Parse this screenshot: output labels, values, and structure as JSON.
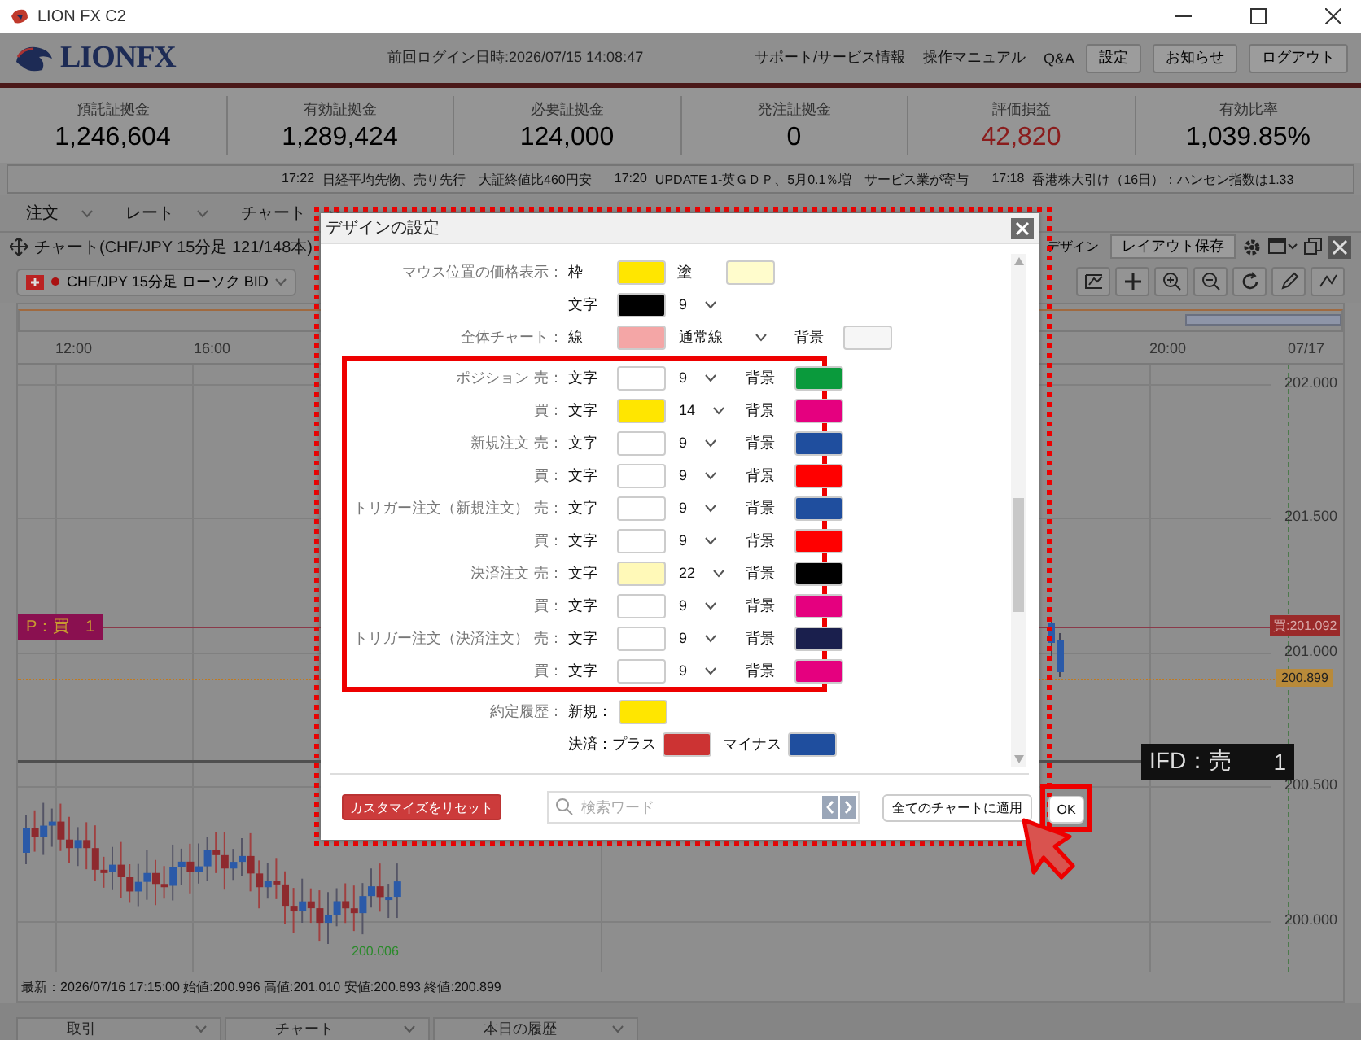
{
  "window": {
    "title": "LION FX C2"
  },
  "header": {
    "logo": "LIONFX",
    "last_login": "前回ログイン日時:2026/07/15 14:08:47",
    "links": [
      "サポート/サービス情報",
      "操作マニュアル",
      "Q&A"
    ],
    "buttons": [
      "設定",
      "お知らせ",
      "ログアウト"
    ]
  },
  "summary": [
    {
      "label": "預託証拠金",
      "value": "1,246,604",
      "kind": "plain"
    },
    {
      "label": "有効証拠金",
      "value": "1,289,424",
      "kind": "plain"
    },
    {
      "label": "必要証拠金",
      "value": "124,000",
      "kind": "plain"
    },
    {
      "label": "発注証拠金",
      "value": "0",
      "kind": "plain"
    },
    {
      "label": "評価損益",
      "value": "42,820",
      "kind": "profit"
    },
    {
      "label": "有効比率",
      "value": "1,039.85%",
      "kind": "plain"
    }
  ],
  "news": [
    {
      "time": "17:22",
      "text": "日経平均先物、売り先行　大証終値比460円安"
    },
    {
      "time": "17:20",
      "text": "UPDATE 1-英ＧＤＰ、5月0.1％増　サービス業が寄与"
    },
    {
      "time": "17:18",
      "text": "香港株大引け（16日）：ハンセン指数は1.33"
    }
  ],
  "menu": [
    "注文",
    "レート",
    "チャート"
  ],
  "chart": {
    "title": "チャート(CHF/JPY 15分足 121/148本)",
    "design_label": "デザイン",
    "layout_save": "レイアウト保存",
    "symbol": "CHF/JPY 15分足 ローソク BID",
    "time_labels": [
      "12:00",
      "16:00",
      "20:00",
      "07/17"
    ],
    "price_labels": [
      "202.000",
      "201.500",
      "201.000",
      "200.500",
      "200.000"
    ],
    "position_label": {
      "side": "P：買",
      "qty": "1"
    },
    "position_tag": "買:201.092",
    "last_tag": "200.899",
    "order_label": {
      "text": "IFD：売",
      "qty": "1"
    },
    "low_label": "200.006",
    "status": "最新：2026/07/16 17:15:00 始値:200.996 高値:201.010 安値:200.893 終値:200.899"
  },
  "dialog": {
    "title": "デザインの設定",
    "sections": [
      {
        "highlighted": false,
        "rows": [
          {
            "label": "マウス位置の価格表示：",
            "controls": [
              {
                "kind": "swatch",
                "caption": "枠",
                "color": "#ffe600"
              },
              {
                "kind": "swatch",
                "caption": "塗",
                "color": "#fffccc"
              }
            ]
          },
          {
            "controls": [
              {
                "kind": "swatch",
                "caption": "文字",
                "color": "#000000"
              },
              {
                "kind": "size",
                "value": "9"
              }
            ]
          },
          {
            "label": "全体チャート：",
            "controls": [
              {
                "kind": "swatch",
                "caption": "線",
                "color": "#f4a6a6"
              },
              {
                "kind": "select",
                "value": "通常線"
              },
              {
                "kind": "swatch",
                "caption": "背景",
                "color": "#f6f6f6"
              }
            ]
          }
        ]
      },
      {
        "highlighted": true,
        "rows": [
          {
            "label": "ポジション",
            "side": "売：",
            "controls": [
              {
                "kind": "swatch",
                "caption": "文字",
                "color": "#ffffff"
              },
              {
                "kind": "size",
                "value": "9"
              },
              {
                "kind": "swatch",
                "caption": "背景",
                "color": "#0a9a3c"
              }
            ]
          },
          {
            "side": "買：",
            "controls": [
              {
                "kind": "swatch",
                "caption": "文字",
                "color": "#ffe600"
              },
              {
                "kind": "size",
                "value": "14"
              },
              {
                "kind": "swatch",
                "caption": "背景",
                "color": "#e5007f"
              }
            ]
          },
          {
            "label": "新規注文",
            "side": "売：",
            "controls": [
              {
                "kind": "swatch",
                "caption": "文字",
                "color": "#ffffff"
              },
              {
                "kind": "size",
                "value": "9"
              },
              {
                "kind": "swatch",
                "caption": "背景",
                "color": "#1f4e9e"
              }
            ]
          },
          {
            "side": "買：",
            "controls": [
              {
                "kind": "swatch",
                "caption": "文字",
                "color": "#ffffff"
              },
              {
                "kind": "size",
                "value": "9"
              },
              {
                "kind": "swatch",
                "caption": "背景",
                "color": "#ff0000"
              }
            ]
          },
          {
            "label": "トリガー注文（新規注文）",
            "side": "売：",
            "controls": [
              {
                "kind": "swatch",
                "caption": "文字",
                "color": "#ffffff"
              },
              {
                "kind": "size",
                "value": "9"
              },
              {
                "kind": "swatch",
                "caption": "背景",
                "color": "#1f4e9e"
              }
            ]
          },
          {
            "side": "買：",
            "controls": [
              {
                "kind": "swatch",
                "caption": "文字",
                "color": "#ffffff"
              },
              {
                "kind": "size",
                "value": "9"
              },
              {
                "kind": "swatch",
                "caption": "背景",
                "color": "#ff0000"
              }
            ]
          },
          {
            "label": "決済注文",
            "side": "売：",
            "controls": [
              {
                "kind": "swatch",
                "caption": "文字",
                "color": "#fff9b8"
              },
              {
                "kind": "size",
                "value": "22"
              },
              {
                "kind": "swatch",
                "caption": "背景",
                "color": "#000000"
              }
            ]
          },
          {
            "side": "買：",
            "controls": [
              {
                "kind": "swatch",
                "caption": "文字",
                "color": "#ffffff"
              },
              {
                "kind": "size",
                "value": "9"
              },
              {
                "kind": "swatch",
                "caption": "背景",
                "color": "#e5007f"
              }
            ]
          },
          {
            "label": "トリガー注文（決済注文）",
            "side": "売：",
            "controls": [
              {
                "kind": "swatch",
                "caption": "文字",
                "color": "#ffffff"
              },
              {
                "kind": "size",
                "value": "9"
              },
              {
                "kind": "swatch",
                "caption": "背景",
                "color": "#1a1f4d"
              }
            ]
          },
          {
            "side": "買：",
            "controls": [
              {
                "kind": "swatch",
                "caption": "文字",
                "color": "#ffffff"
              },
              {
                "kind": "size",
                "value": "9"
              },
              {
                "kind": "swatch",
                "caption": "背景",
                "color": "#e5007f"
              }
            ]
          }
        ]
      },
      {
        "highlighted": false,
        "rows": [
          {
            "label": "約定履歴：",
            "controls": [
              {
                "kind": "swatch",
                "caption": "新規：",
                "color": "#ffe600"
              }
            ]
          },
          {
            "controls": [
              {
                "kind": "swatch",
                "caption": "決済：プラス",
                "color": "#cc3333"
              },
              {
                "kind": "swatch",
                "caption": "マイナス",
                "color": "#1f4e9e"
              }
            ]
          }
        ]
      }
    ],
    "reset_button": "カスタマイズをリセット",
    "search": {
      "placeholder": "検索ワード"
    },
    "apply_all_button": "全てのチャートに適用",
    "ok_button": "OK",
    "ok_highlighted": true
  },
  "bottom_tabs": [
    {
      "label": "取引"
    },
    {
      "label": "チャート"
    },
    {
      "label": "本日の履歴"
    }
  ]
}
